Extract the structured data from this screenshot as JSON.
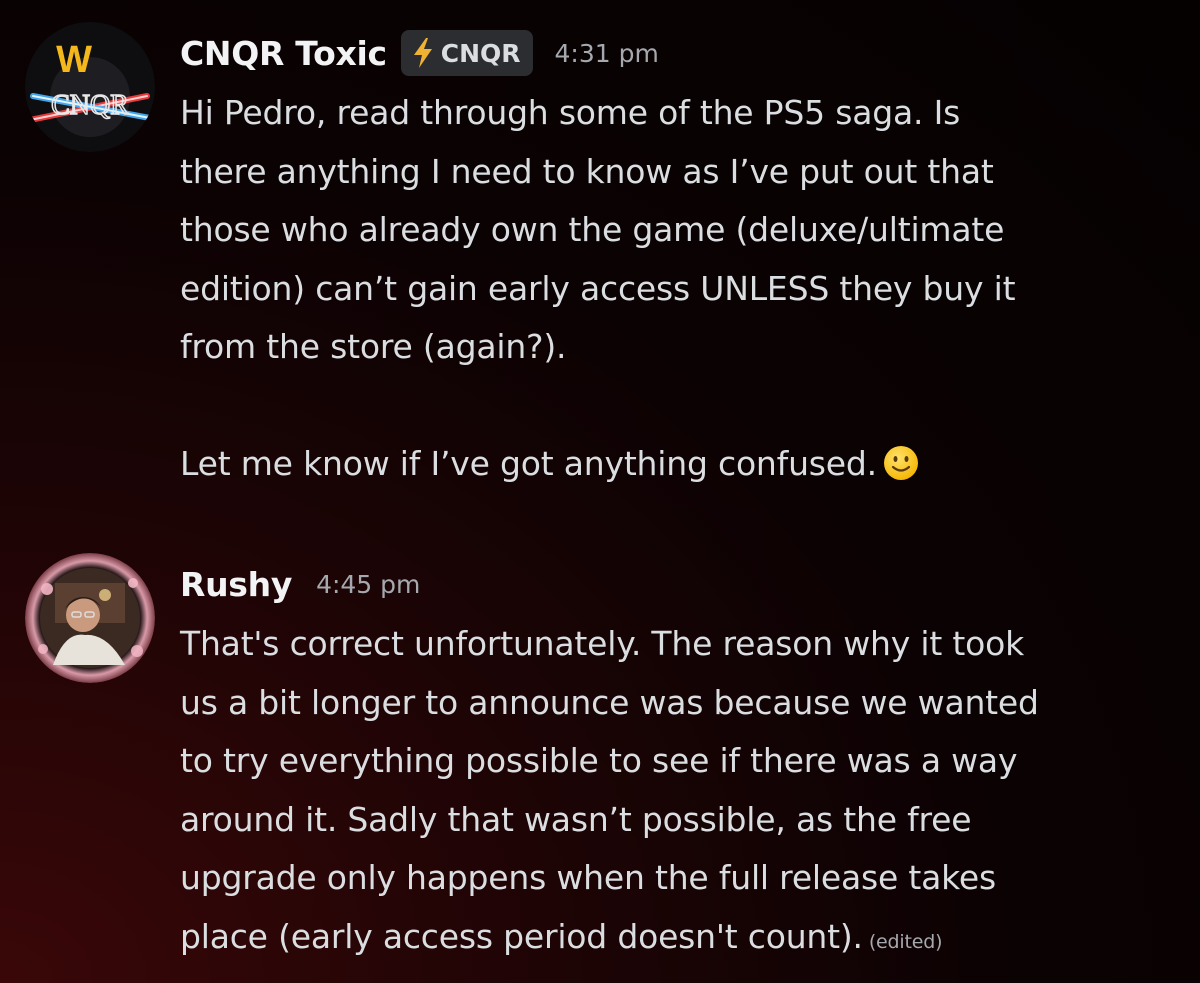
{
  "messages": [
    {
      "username": "CNQR Toxic",
      "tag": "CNQR",
      "tag_icon": "lightning-icon",
      "timestamp": "4:31 pm",
      "avatar_text_top": "W",
      "avatar_text_bottom": "CNQR",
      "lines": [
        "Hi Pedro, read through some of the PS5 saga. Is",
        "there anything I need to know as I’ve put out that",
        "those who already own the game (deluxe/ultimate",
        "edition) can’t gain early access UNLESS they buy it",
        "from the store (again?)."
      ],
      "final_line": "Let me know if I’ve got anything confused.",
      "emoji": "slightly-smiling-face-icon"
    },
    {
      "username": "Rushy",
      "timestamp": "4:45 pm",
      "lines": [
        "That's correct unfortunately. The reason why it took",
        "us a bit longer to announce was because we wanted",
        "to try everything possible to see if there was a way",
        "around it. Sadly that wasn’t possible, as the free",
        "upgrade only happens when the full release takes"
      ],
      "final_line": "place (early access period doesn't count).",
      "edited_label": "(edited)"
    }
  ],
  "colors": {
    "username": "#f2f3f5",
    "text": "#dbdee1",
    "timestamp": "#a5a8ad",
    "tag_bg": "#2b2d31",
    "lightning": "#f0b232",
    "background_accent": "#3a0708"
  }
}
